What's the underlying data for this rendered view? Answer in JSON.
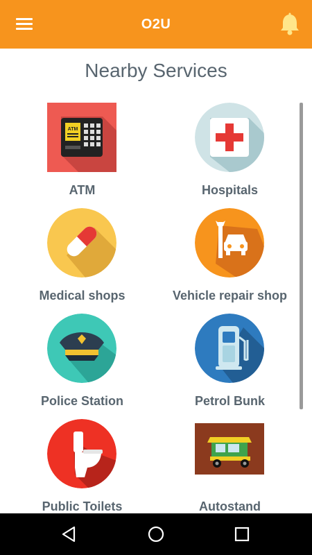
{
  "app": {
    "title": "O2U",
    "accent_color": "#F7941D"
  },
  "icons": {
    "menu": "hamburger-menu-icon",
    "notifications": "bell-icon"
  },
  "page": {
    "title": "Nearby Services"
  },
  "services": [
    {
      "label": "ATM",
      "icon": "atm-machine-icon",
      "color": "#EE5A52"
    },
    {
      "label": "Hospitals",
      "icon": "first-aid-cross-icon",
      "color": "#CFE3E6"
    },
    {
      "label": "Medical shops",
      "icon": "pill-capsule-icon",
      "color": "#F9C74F"
    },
    {
      "label": "Vehicle repair shop",
      "icon": "car-wrench-icon",
      "color": "#F7941D"
    },
    {
      "label": "Police Station",
      "icon": "police-cap-icon",
      "color": "#3EC8B6"
    },
    {
      "label": "Petrol Bunk",
      "icon": "fuel-pump-icon",
      "color": "#2E7BBF"
    },
    {
      "label": "Public Toilets",
      "icon": "toilet-icon",
      "color": "#EE3124"
    },
    {
      "label": "Autostand",
      "icon": "auto-rickshaw-icon",
      "color": "#8B3A1E"
    }
  ],
  "system_nav": {
    "back": "back-triangle-icon",
    "home": "home-circle-icon",
    "recent": "recent-apps-square-icon"
  }
}
